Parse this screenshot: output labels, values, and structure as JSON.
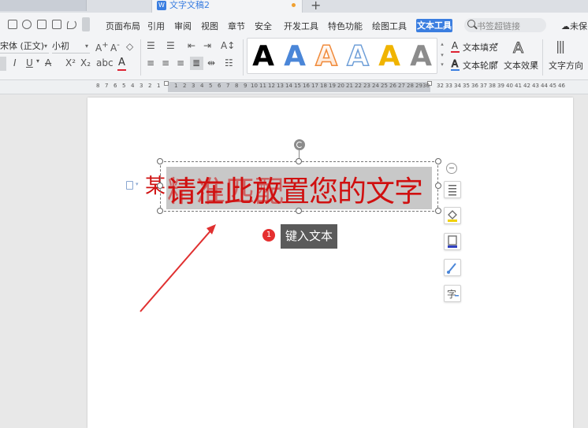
{
  "tabbar": {
    "doc_title": "文字文稿2",
    "new_tab": "+"
  },
  "menu": {
    "items": [
      "页面布局",
      "引用",
      "审阅",
      "视图",
      "章节",
      "安全",
      "开发工具",
      "特色功能",
      "绘图工具"
    ],
    "active_tab": "文本工具",
    "search_placeholder": "书签超链接",
    "cloud_status": "未保"
  },
  "ribbon": {
    "font_name": "宋体 (正文)",
    "font_size": "小初",
    "wordart_styles": [
      {
        "name": "black-solid",
        "color": "#000000"
      },
      {
        "name": "blue-solid",
        "color": "#4a86d8"
      },
      {
        "name": "orange-outline",
        "color": "#f08a3a"
      },
      {
        "name": "blue-outline",
        "color": "#6f9fd8"
      },
      {
        "name": "yellow-solid",
        "color": "#f0b400"
      },
      {
        "name": "gray-gradient",
        "color": "#8c8c8c"
      }
    ],
    "text_fill": "文本填充",
    "text_outline": "文本轮廓",
    "text_effect": "文本效果",
    "text_direction": "文字方向"
  },
  "document": {
    "heading_partial": "某",
    "wordart_text": "请在此放置您的文字",
    "underlying_text": "精准匹配",
    "tooltip": "键入文本",
    "step_badge": "1"
  },
  "colors": {
    "accent": "#3b7ee0",
    "text_red": "#d01010",
    "tooltip_bg": "#5a5a5a"
  }
}
